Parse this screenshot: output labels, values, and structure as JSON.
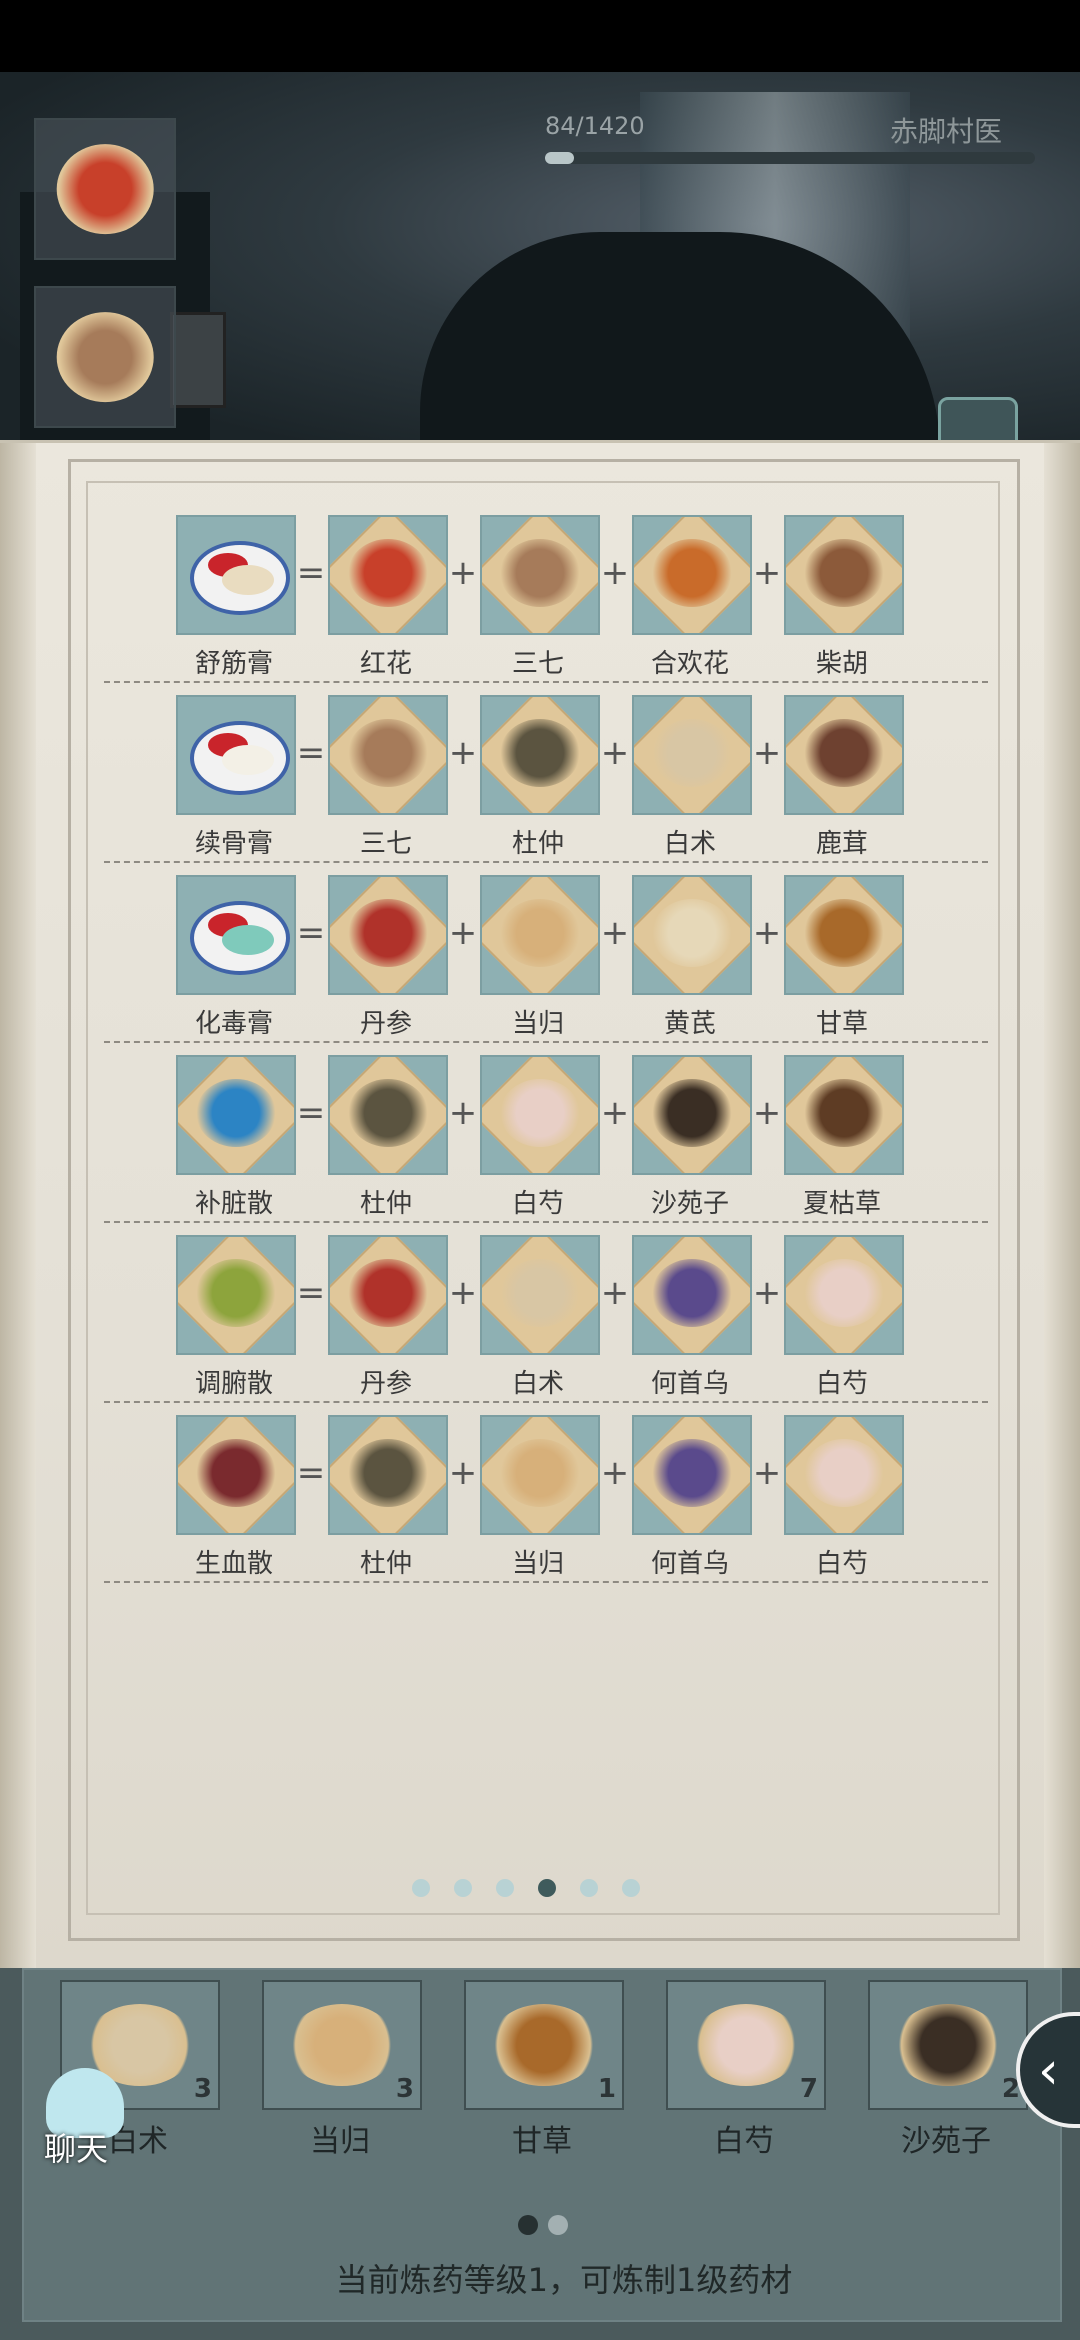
{
  "header": {
    "xp_text": "84/1420",
    "xp_progress": 0.059,
    "role": "赤脚村医"
  },
  "page_nav": {
    "total_pages": 6,
    "current_page": 4
  },
  "recipes": [
    {
      "result": "舒筋膏",
      "result_kind": "ointment",
      "result_color": "#e9dcc0",
      "ingredients": [
        {
          "name": "红花",
          "color": "#c8402a"
        },
        {
          "name": "三七",
          "color": "#a67b5a"
        },
        {
          "name": "合欢花",
          "color": "#c96b2a"
        },
        {
          "name": "柴胡",
          "color": "#8c5a3a"
        }
      ]
    },
    {
      "result": "续骨膏",
      "result_kind": "ointment",
      "result_color": "#f3f0e6",
      "ingredients": [
        {
          "name": "三七",
          "color": "#a67b5a"
        },
        {
          "name": "杜仲",
          "color": "#5b5440"
        },
        {
          "name": "白术",
          "color": "#d8c6a4"
        },
        {
          "name": "鹿茸",
          "color": "#6e4130"
        }
      ]
    },
    {
      "result": "化毒膏",
      "result_kind": "ointment",
      "result_color": "#7fcabb",
      "ingredients": [
        {
          "name": "丹参",
          "color": "#b0322a"
        },
        {
          "name": "当归",
          "color": "#d7b07a"
        },
        {
          "name": "黄芪",
          "color": "#e6d8b8"
        },
        {
          "name": "甘草",
          "color": "#a8692a"
        }
      ]
    },
    {
      "result": "补脏散",
      "result_kind": "powder",
      "result_color": "#2c84c4",
      "ingredients": [
        {
          "name": "杜仲",
          "color": "#5b5440"
        },
        {
          "name": "白芍",
          "color": "#e8cfc6"
        },
        {
          "name": "沙苑子",
          "color": "#3a2e24"
        },
        {
          "name": "夏枯草",
          "color": "#5e3c24"
        }
      ]
    },
    {
      "result": "调腑散",
      "result_kind": "powder",
      "result_color": "#8da43c",
      "ingredients": [
        {
          "name": "丹参",
          "color": "#b0322a"
        },
        {
          "name": "白术",
          "color": "#d8c6a4"
        },
        {
          "name": "何首乌",
          "color": "#5a4a8c"
        },
        {
          "name": "白芍",
          "color": "#e8cfc6"
        }
      ]
    },
    {
      "result": "生血散",
      "result_kind": "powder",
      "result_color": "#7a2a2e",
      "ingredients": [
        {
          "name": "杜仲",
          "color": "#5b5440"
        },
        {
          "name": "当归",
          "color": "#d7b07a"
        },
        {
          "name": "何首乌",
          "color": "#5a4a8c"
        },
        {
          "name": "白芍",
          "color": "#e8cfc6"
        }
      ]
    }
  ],
  "inventory": [
    {
      "name": "白术",
      "count": "3",
      "color": "#d8c6a4"
    },
    {
      "name": "当归",
      "count": "3",
      "color": "#d7b07a"
    },
    {
      "name": "甘草",
      "count": "1",
      "color": "#a8692a"
    },
    {
      "name": "白芍",
      "count": "7",
      "color": "#e8cfc6"
    },
    {
      "name": "沙苑子",
      "count": "2",
      "color": "#3a2e24"
    }
  ],
  "tray_page": {
    "total_pages": 2,
    "current_page": 1
  },
  "level_text": "当前炼药等级1，可炼制1级药材",
  "chat_label": "聊天",
  "back_symbol": "‹",
  "side_items": [
    {
      "icon": "safflower",
      "color": "#c8402a"
    },
    {
      "icon": "sanqi",
      "color": "#a67b5a"
    }
  ]
}
